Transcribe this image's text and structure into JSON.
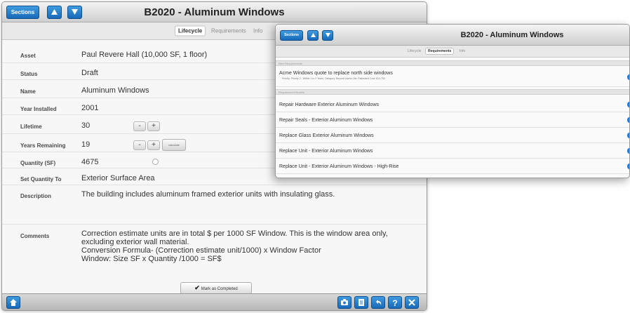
{
  "back_window": {
    "nav": {
      "sections_label": "Sections",
      "up_icon": "triangle-up",
      "down_icon": "triangle-down"
    },
    "title": "B2020 - Aluminum Windows",
    "tabs": [
      {
        "label": "Lifecycle",
        "active": true
      },
      {
        "label": "Requirements",
        "active": false
      },
      {
        "label": "Info",
        "active": false
      }
    ],
    "fields": {
      "asset": {
        "label": "Asset",
        "value": "Paul Revere Hall (10,000 SF, 1 floor)"
      },
      "status": {
        "label": "Status",
        "value": "Draft"
      },
      "name": {
        "label": "Name",
        "value": "Aluminum Windows"
      },
      "year_installed": {
        "label": "Year Installed",
        "value": "2001"
      },
      "lifetime": {
        "label": "Lifetime",
        "value": "30"
      },
      "years_remaining": {
        "label": "Years Remaining",
        "value": "19"
      },
      "quantity": {
        "label": "Quantity (SF)",
        "value": "4675"
      },
      "set_quantity_to": {
        "label": "Set Quantity To",
        "value": "Exterior Surface Area"
      },
      "description": {
        "label": "Description",
        "value": "The building includes aluminum framed exterior units with insulating glass."
      },
      "comments": {
        "label": "Comments",
        "value": "Correction estimate units are in total $ per 1000 SF Window. This is the window area only, excluding exterior wall material.\nConversion Formula- (Correction estimate unit/1000) x Window Factor\nWindow: Size SF x Quantity /1000 = SF$"
      }
    },
    "stepper": {
      "minus": "-",
      "plus": "+"
    },
    "calculate_label": "calculate",
    "mark_completed_label": "Mark as Completed",
    "bottom_toolbar": {
      "home_icon": "home",
      "camera_icon": "camera",
      "document_icon": "document",
      "undo_icon": "undo-arrow",
      "help_label": "?",
      "tools_icon": "tools"
    },
    "colors": {
      "accent": "#1f74c4"
    }
  },
  "front_window": {
    "nav": {
      "sections_label": "Sections"
    },
    "title": "B2020 - Aluminum Windows",
    "tabs": [
      {
        "label": "Lifecycle",
        "active": false
      },
      {
        "label": "Requirements",
        "active": true
      },
      {
        "label": "Info",
        "active": false
      }
    ],
    "new_requirements_header": "New Requirements",
    "requirement": {
      "title": "Acme Windows quote to replace north side windows",
      "detail": "Priority: Priority 2 - Within 1 to 2 Years, Category: Beyond Useful Life, Estimated Cost: $13,750."
    },
    "requirement_models_header": "Requirement Models",
    "models": [
      "Repair Hardware Exterior Aluminum Windows",
      "Repair Seals - Exterior Aluminum Windows",
      "Replace Glass Exterior Aluminum Windows",
      "Replace Unit - Exterior Aluminum Windows",
      "Replace Unit - Exterior Aluminum Windows - High-Rise"
    ]
  }
}
